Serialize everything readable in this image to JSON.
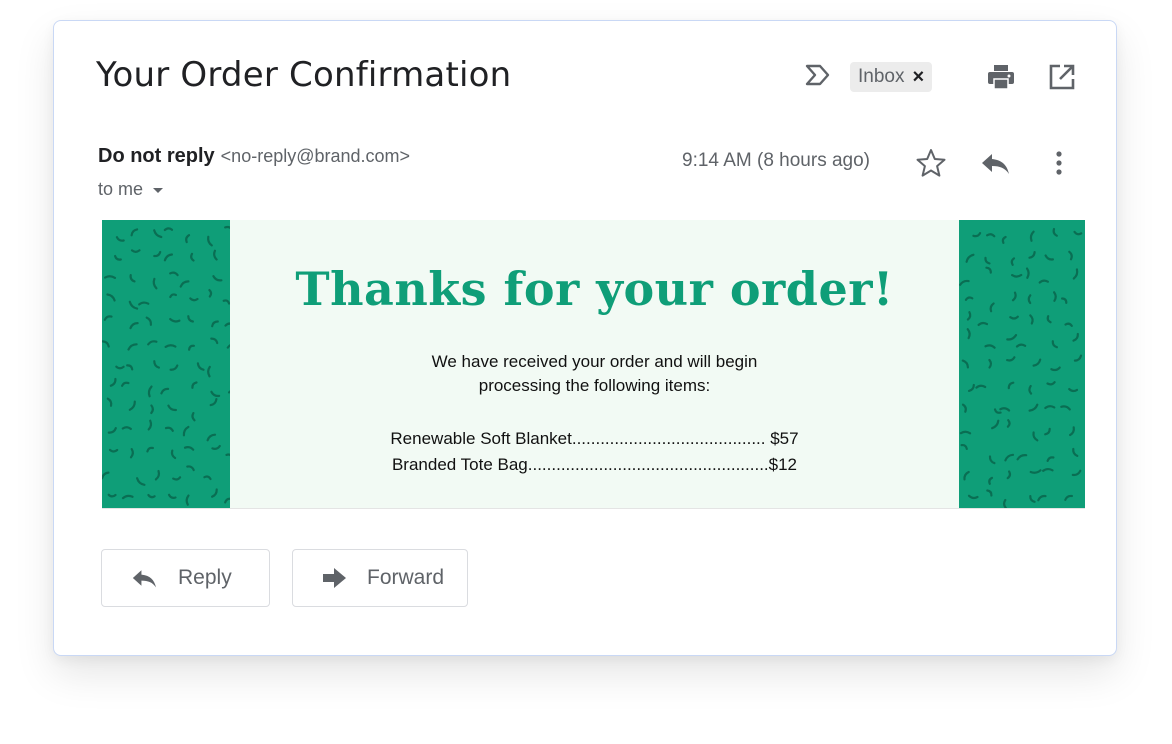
{
  "email": {
    "subject": "Your Order Confirmation",
    "label": "Inbox",
    "label_close": "×",
    "sender_name": "Do not reply",
    "sender_email": "<no-reply@brand.com>",
    "recipient": "to me",
    "time": "9:14 AM",
    "relative_time": "(8 hours ago)"
  },
  "banner": {
    "title": "Thanks for your order!",
    "body_line1": "We have received your order and will begin",
    "body_line2": "processing the following items:",
    "items": [
      "Renewable Soft Blanket......................................... $57",
      "Branded Tote Bag...................................................$12"
    ]
  },
  "actions": {
    "reply": "Reply",
    "forward": "Forward"
  },
  "colors": {
    "accent": "#0f9e78",
    "banner_bg": "#f2faf4",
    "text_primary": "#202124",
    "text_secondary": "#5f6368"
  },
  "icons": [
    "importance-icon",
    "print-icon",
    "open-in-new-icon",
    "star-icon",
    "reply-icon",
    "more-vert-icon",
    "forward-icon"
  ]
}
